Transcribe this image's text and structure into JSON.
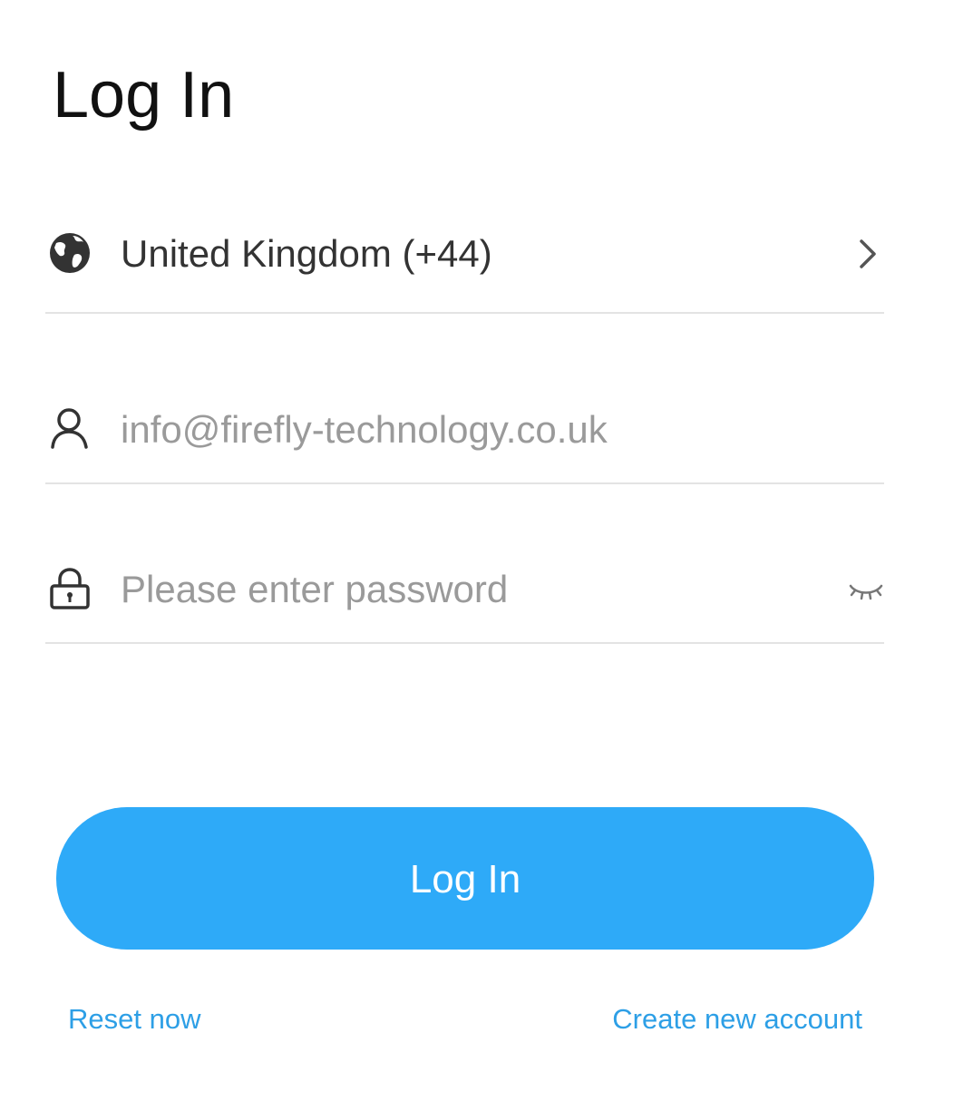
{
  "page": {
    "title": "Log In"
  },
  "form": {
    "country": {
      "value": "United Kingdom (+44)",
      "icon": "globe-icon",
      "trailing_icon": "chevron-right-icon"
    },
    "email": {
      "value": "info@firefly-technology.co.uk",
      "icon": "user-icon"
    },
    "password": {
      "placeholder": "Please enter password",
      "icon": "lock-icon",
      "trailing_icon": "eye-closed-icon"
    }
  },
  "actions": {
    "login_label": "Log In",
    "reset_label": "Reset now",
    "create_label": "Create new account"
  },
  "colors": {
    "accent": "#2eaaf8",
    "link": "#2d9fe6",
    "divider": "#e3e3e3"
  }
}
